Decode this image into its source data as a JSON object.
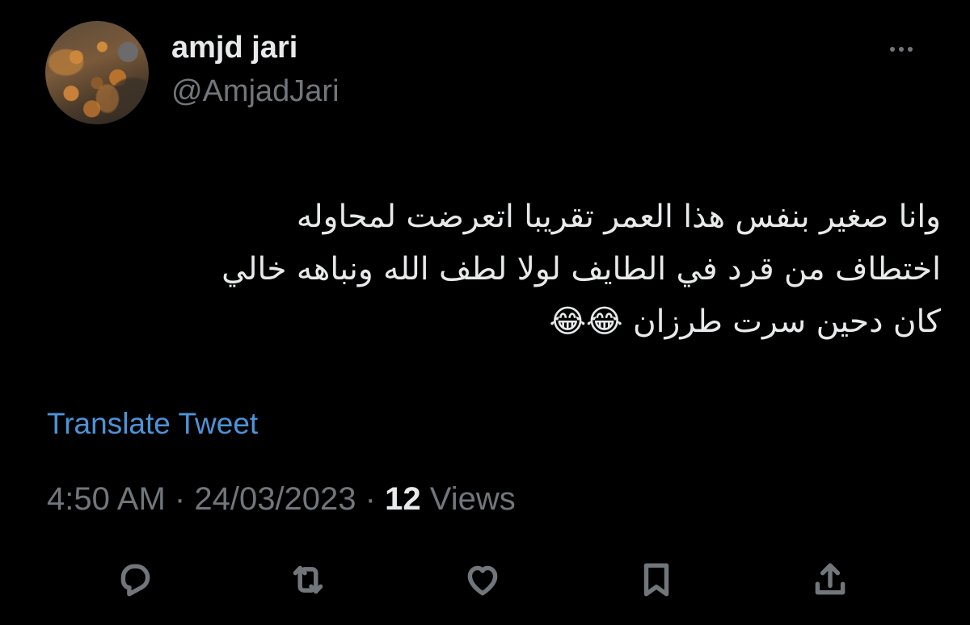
{
  "author": {
    "display_name": "amjd jari",
    "handle": "@AmjadJari",
    "avatar": "avatar-photo"
  },
  "tweet": {
    "lines": [
      "وانا صغير بنفس هذا العمر تقريبا  اتعرضت لمحاوله",
      "اختطاف من قرد في الطايف لولا لطف الله ونباهه خالي",
      "كان دحين سرت طرزان 😂😂"
    ]
  },
  "translate_label": "Translate Tweet",
  "meta": {
    "time": "4:50 AM",
    "separator": "·",
    "date": "24/03/2023",
    "views_count": "12",
    "views_label": "Views"
  },
  "actions": {
    "reply": "reply-icon",
    "retweet": "retweet-icon",
    "like": "heart-icon",
    "bookmark": "bookmark-icon",
    "share": "share-icon"
  },
  "colors": {
    "background": "#000000",
    "text": "#e7e9ea",
    "secondary": "#71767b",
    "link": "#4d93d8"
  }
}
